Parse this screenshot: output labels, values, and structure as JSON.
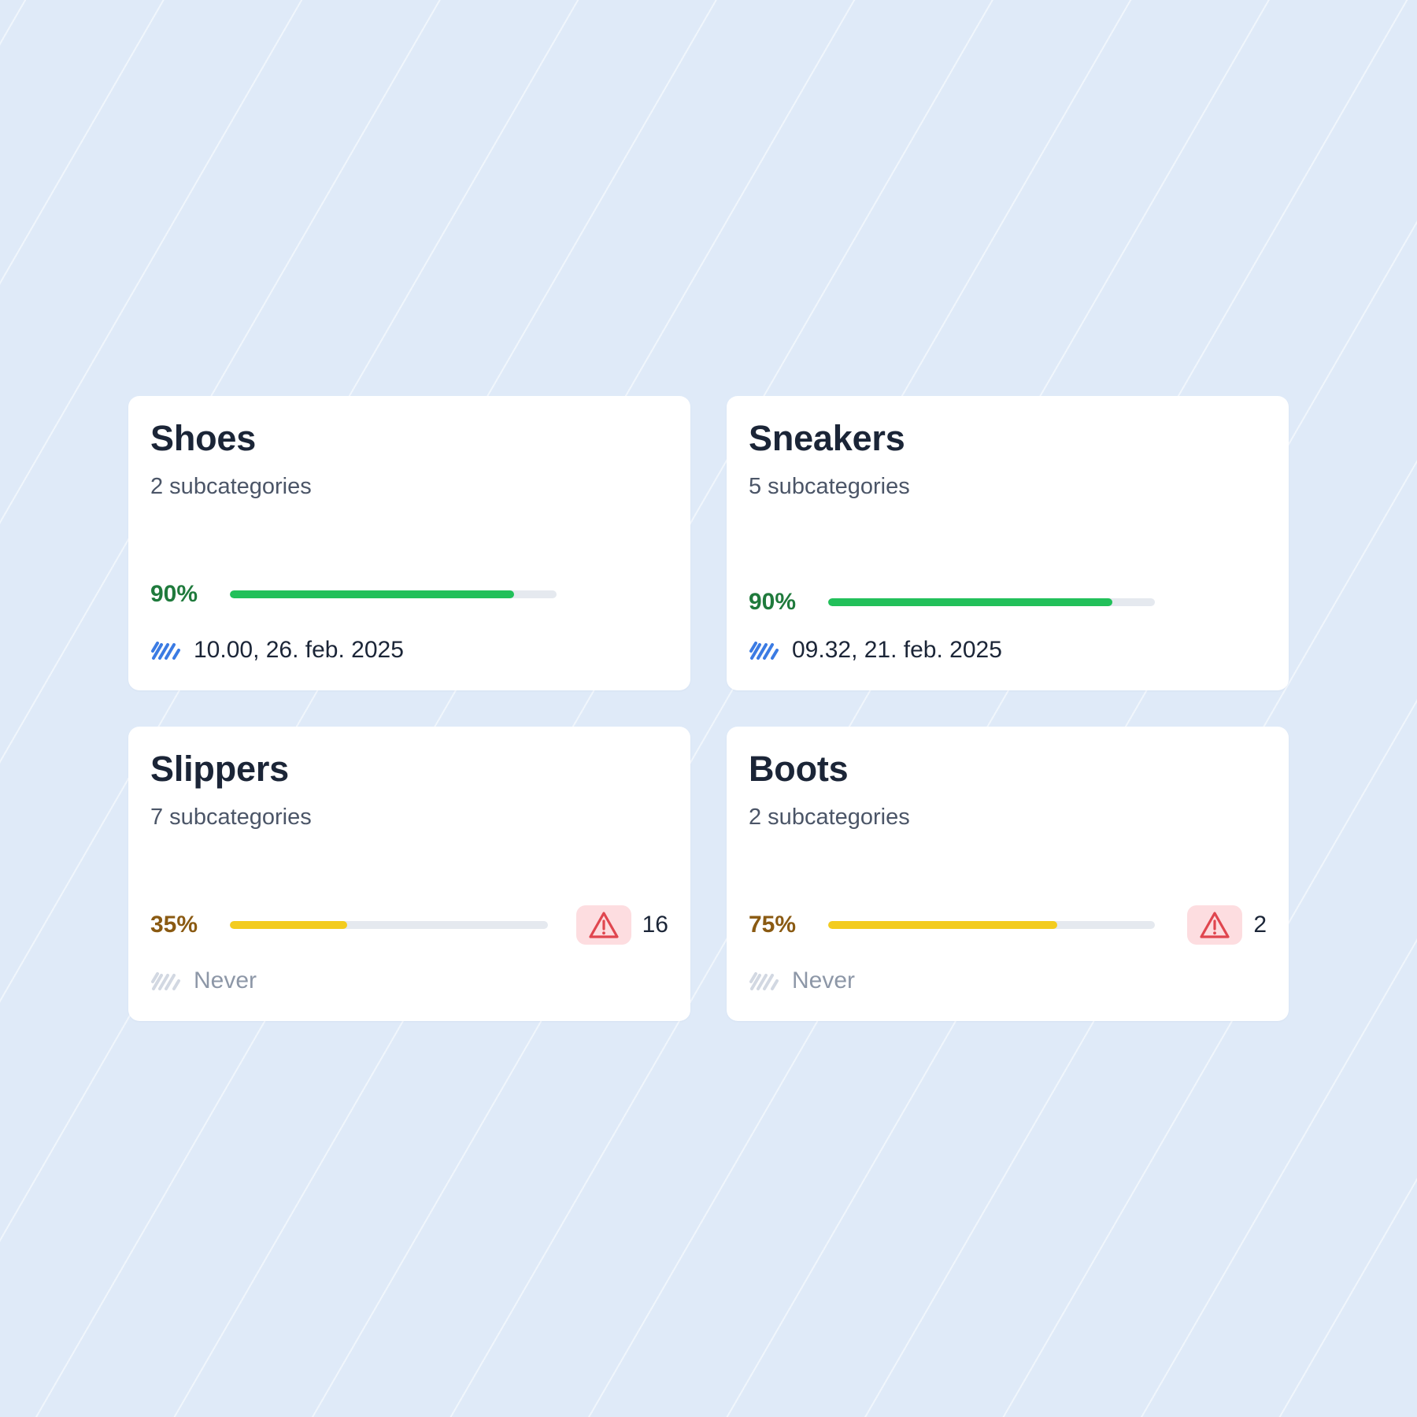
{
  "colors": {
    "background": "#dfeaf8",
    "card": "#ffffff",
    "good": "#22c05a",
    "good_text": "#1f7a3c",
    "warn": "#f3cc1f",
    "warn_text": "#8a5a12",
    "alert_bg": "#fddde0",
    "alert_icon": "#e0464f",
    "sync_active": "#3b7be3",
    "sync_inactive": "#d2d8e2"
  },
  "cards": [
    {
      "title": "Shoes",
      "subtitle": "2 subcategories",
      "percent_label": "90%",
      "progress": 0.87,
      "status": "good",
      "sync_icon": "sync-active-icon",
      "sync_text": "10.00, 26. feb. 2025"
    },
    {
      "title": "Sneakers",
      "subtitle": "5 subcategories",
      "percent_label": "90%",
      "progress": 0.87,
      "status": "good",
      "sync_icon": "sync-active-icon",
      "sync_text": "09.32, 21. feb. 2025"
    },
    {
      "title": "Slippers",
      "subtitle": "7 subcategories",
      "percent_label": "35%",
      "progress": 0.37,
      "status": "warn",
      "alert_icon": "warning-triangle-icon",
      "alert_count": "16",
      "sync_icon": "sync-inactive-icon",
      "sync_text": "Never"
    },
    {
      "title": "Boots",
      "subtitle": "2 subcategories",
      "percent_label": "75%",
      "progress": 0.7,
      "status": "warn",
      "alert_icon": "warning-triangle-icon",
      "alert_count": "2",
      "sync_icon": "sync-inactive-icon",
      "sync_text": "Never"
    }
  ]
}
